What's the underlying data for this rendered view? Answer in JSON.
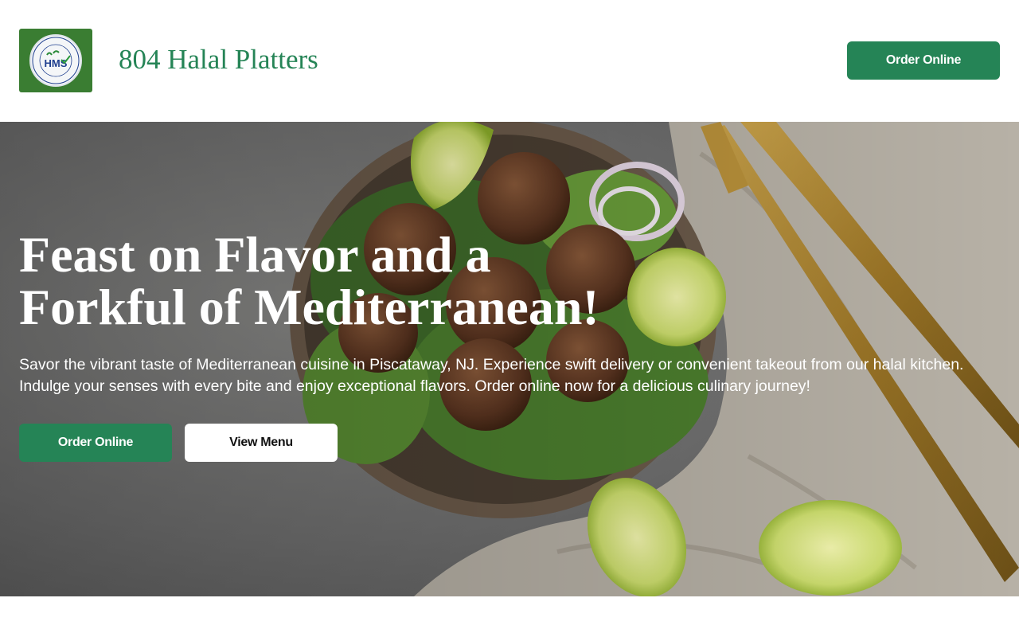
{
  "header": {
    "logo_alt": "HMS",
    "logo_lettering": "HALAL MONITORING SERVICES · CERTIFIED HAND ZABIHA",
    "brand_name": "804 Halal Platters",
    "order_button": "Order Online"
  },
  "hero": {
    "title_line1": "Feast on Flavor and a",
    "title_line2": "Forkful of Mediterranean!",
    "description": "Savor the vibrant taste of Mediterranean cuisine in Piscataway, NJ. Experience swift delivery or convenient takeout from our halal kitchen. Indulge your senses with every bite and enjoy exceptional flavors. Order online now for a delicious culinary journey!",
    "order_button": "Order Online",
    "menu_button": "View Menu"
  },
  "colors": {
    "brand_green": "#258456",
    "logo_green": "#3a7d32",
    "white": "#ffffff"
  }
}
